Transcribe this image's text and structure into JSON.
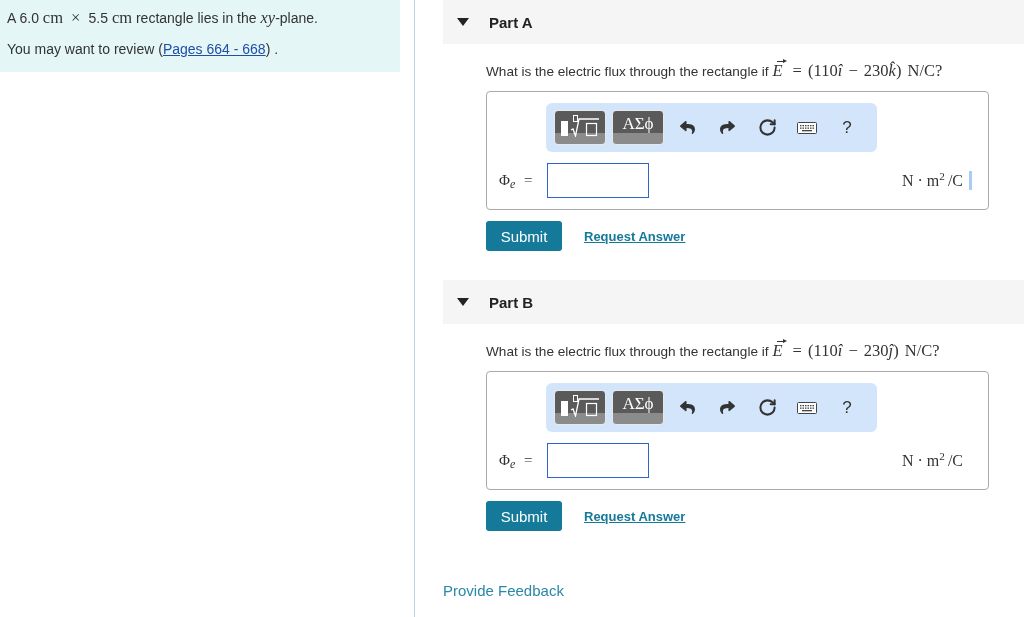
{
  "intro": {
    "statement": [
      {
        "kind": "text",
        "text": "A 6.0 "
      },
      {
        "kind": "math",
        "text": "cm × "
      },
      {
        "kind": "text",
        "text": "5.5 "
      },
      {
        "kind": "math",
        "text": "cm"
      },
      {
        "kind": "text",
        "text": " rectangle lies in the "
      },
      {
        "kind": "math",
        "text": "*xy*"
      },
      {
        "kind": "text",
        "text": "-plane."
      }
    ],
    "review": {
      "before": "You may want to review (",
      "link": "Pages 664 - 668",
      "after": ") ."
    }
  },
  "parts": [
    {
      "title": "Part A",
      "expanded": true,
      "question": {
        "text": "What is the electric flux through the rectangle if",
        "formula": [
          {
            "kind": "vector",
            "text": "E"
          },
          {
            "kind": "roman",
            "text": " = (110"
          },
          {
            "kind": "italic",
            "text": "î"
          },
          {
            "kind": "roman",
            "text": " − 230"
          },
          {
            "kind": "italic",
            "text": "k̂"
          },
          {
            "kind": "roman",
            "text": ") N/C?"
          }
        ]
      },
      "toolbar": [
        {
          "kind": "templates"
        },
        {
          "kind": "symbols",
          "label": "ΑΣϕ"
        },
        {
          "kind": "undo"
        },
        {
          "kind": "redo"
        },
        {
          "kind": "reset"
        },
        {
          "kind": "keyboard"
        },
        {
          "kind": "help",
          "label": "?"
        }
      ],
      "answer": {
        "label": "Φ$_{e}$ =",
        "units": "N · m$^{2}$/C",
        "cursor": true
      },
      "submit": "Submit",
      "request": "Request Answer"
    },
    {
      "title": "Part B",
      "expanded": true,
      "question": {
        "text": "What is the electric flux through the rectangle if",
        "formula": [
          {
            "kind": "vector",
            "text": "E"
          },
          {
            "kind": "roman",
            "text": " = (110"
          },
          {
            "kind": "italic",
            "text": "î"
          },
          {
            "kind": "roman",
            "text": " − 230"
          },
          {
            "kind": "italic",
            "text": "ĵ"
          },
          {
            "kind": "roman",
            "text": ") N/C?"
          }
        ]
      },
      "toolbar": [
        {
          "kind": "templates"
        },
        {
          "kind": "symbols",
          "label": "ΑΣϕ"
        },
        {
          "kind": "undo"
        },
        {
          "kind": "redo"
        },
        {
          "kind": "reset"
        },
        {
          "kind": "keyboard"
        },
        {
          "kind": "help",
          "label": "?"
        }
      ],
      "answer": {
        "label": "Φ$_{e}$ =",
        "units": "N · m$^{2}$/C",
        "cursor": false
      },
      "submit": "Submit",
      "request": "Request Answer"
    }
  ],
  "feedback": "Provide Feedback"
}
